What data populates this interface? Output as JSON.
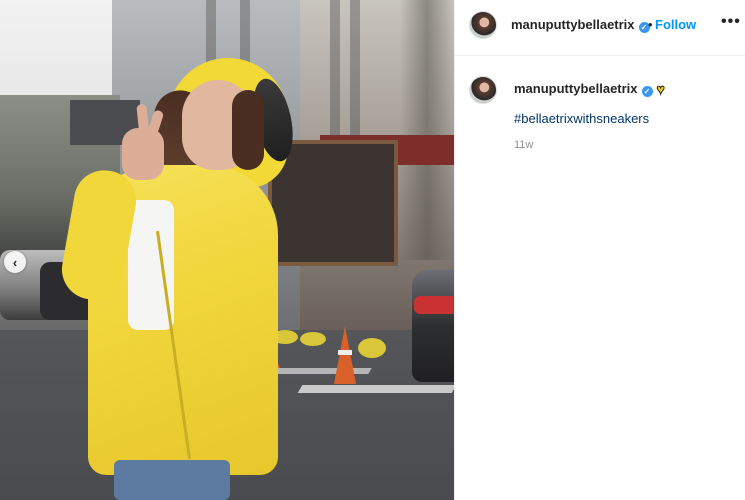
{
  "post": {
    "author": {
      "username": "manuputtybellaetrix",
      "verified": true
    },
    "follow_label": "Follow",
    "separator": "•",
    "more_options_icon": "more-horizontal-icon",
    "more_options_glyph": "•••",
    "carousel_prev_glyph": "‹"
  },
  "caption": {
    "username": "manuputtybellaetrix",
    "emoji": "♥",
    "hashtag": "#bellaetrixwithsneakers",
    "timestamp": "11w"
  },
  "colors": {
    "follow": "#0095f6",
    "hashtag": "#00376b",
    "verified": "#3897f0",
    "emoji": "#f5d000"
  }
}
